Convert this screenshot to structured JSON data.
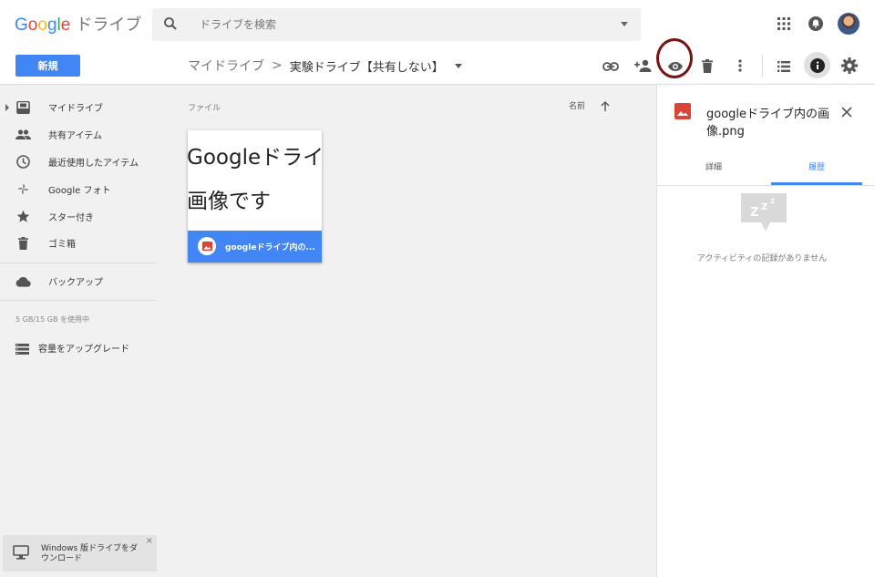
{
  "header": {
    "logo_google": [
      "G",
      "o",
      "o",
      "g",
      "l",
      "e"
    ],
    "logo_product": "ドライブ",
    "search_placeholder": "ドライブを検索"
  },
  "toolbar": {
    "new_label": "新規",
    "breadcrumb_root": "マイドライブ",
    "breadcrumb_separator": ">",
    "breadcrumb_current": "実験ドライブ【共有しない】"
  },
  "sidebar": {
    "items": [
      {
        "label": "マイドライブ",
        "icon": "drive-icon"
      },
      {
        "label": "共有アイテム",
        "icon": "people-icon"
      },
      {
        "label": "最近使用したアイテム",
        "icon": "clock-icon"
      },
      {
        "label": "Google フォト",
        "icon": "pinwheel-icon"
      },
      {
        "label": "スター付き",
        "icon": "star-icon"
      },
      {
        "label": "ゴミ箱",
        "icon": "trash-icon"
      },
      {
        "label": "バックアップ",
        "icon": "cloud-icon"
      }
    ],
    "storage": "5 GB/15 GB を使用中",
    "upgrade_label": "容量をアップグレード",
    "download_label": "Windows 版ドライブをダウンロード",
    "download_close": "×"
  },
  "main": {
    "section_label": "ファイル",
    "sort_label": "名前",
    "file": {
      "thumb_line1": "Googleドライブ内の",
      "thumb_line2": "画像です",
      "name": "googleドライブ内の..."
    }
  },
  "panel": {
    "title": "googleドライブ内の画像.png",
    "tab_details": "詳細",
    "tab_activity": "履歴",
    "empty_message": "アクティビティの記録がありません"
  },
  "colors": {
    "accent": "#4285f4",
    "highlight_ring": "#7a1212",
    "image_icon": "#db4437"
  }
}
